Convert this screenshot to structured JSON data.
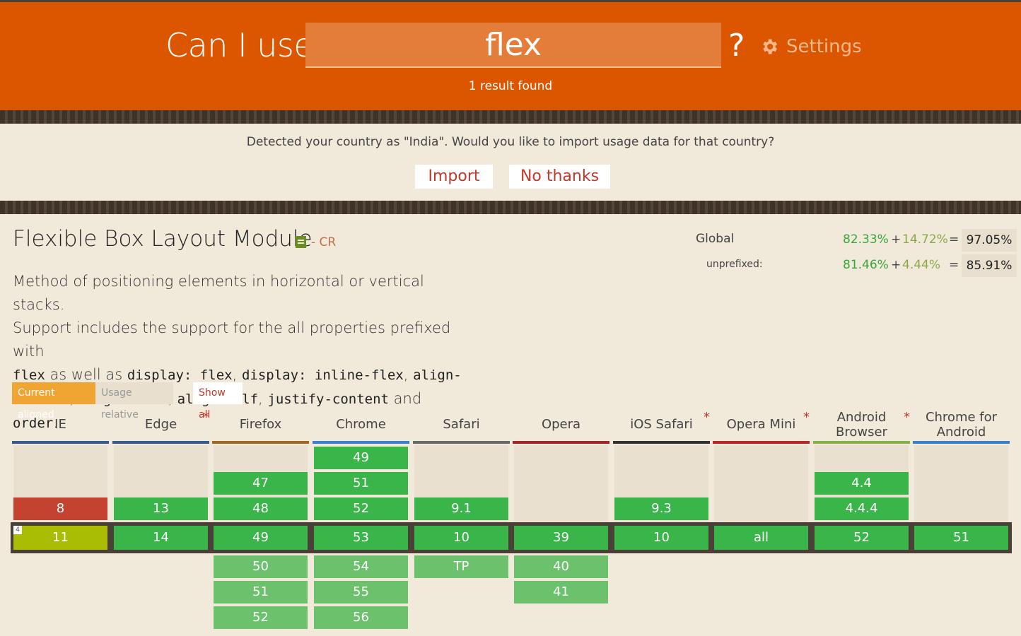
{
  "header": {
    "brand": "Can I use",
    "search_value": "flex",
    "question_mark": "?",
    "settings_label": "Settings",
    "results": "1 result found"
  },
  "notice": {
    "text": "Detected your country as \"India\". Would you like to import usage data for that country?",
    "import_label": "Import",
    "no_thanks_label": "No thanks"
  },
  "feature": {
    "title": "Flexible Box Layout Module",
    "status": "- CR",
    "description_line1": "Method of positioning elements in horizontal or vertical stacks.",
    "description_line2": "Support includes the support for the all properties prefixed with",
    "code_flex": "flex",
    "text_as_well_as": " as well as ",
    "code_display_flex": "display: flex",
    "comma": ", ",
    "code_display_inline_flex": "display: inline-flex",
    "code_align": "align-",
    "code_content": "content",
    "code_align_items": "align-items",
    "code_align_self": "align-self",
    "code_justify_content": "justify-content",
    "text_and": " and ",
    "code_order": "order",
    "period": "."
  },
  "stats": {
    "global_label": "Global",
    "global_full": "82.33%",
    "global_partial": "14.72%",
    "global_total": "97.05%",
    "unprefixed_label": "unprefixed:",
    "unprefixed_full": "81.46%",
    "unprefixed_partial": "4.44%",
    "unprefixed_total": "85.91%",
    "plus": "+",
    "equals": "="
  },
  "toggles": {
    "current_aligned": "Current aligned",
    "usage_relative": "Usage relative",
    "show_all": "Show all"
  },
  "browsers": [
    {
      "name": "IE",
      "color": "#3a5b8c",
      "star": ""
    },
    {
      "name": "Edge",
      "color": "#3a5b8c",
      "star": "*"
    },
    {
      "name": "Firefox",
      "color": "#a1682a",
      "star": ""
    },
    {
      "name": "Chrome",
      "color": "#3f7fc7",
      "star": ""
    },
    {
      "name": "Safari",
      "color": "#6a6a6a",
      "star": ""
    },
    {
      "name": "Opera",
      "color": "#9d2a2a",
      "star": ""
    },
    {
      "name": "iOS Safari",
      "color": "#333333",
      "star": "*"
    },
    {
      "name": "Opera Mini",
      "color": "#b22a2a",
      "star": "*"
    },
    {
      "name": "Android Browser",
      "color": "#88b04b",
      "star": "*"
    },
    {
      "name": "Chrome for Android",
      "color": "#3f7fc7",
      "star": ""
    }
  ],
  "versions": {
    "ie": {
      "past2": "8",
      "current": "11",
      "note": "4"
    },
    "edge": {
      "past2": "13",
      "current": "14"
    },
    "firefox": {
      "past1": "47",
      "past2": "48",
      "current": "49",
      "future1": "50",
      "future2": "51",
      "future3": "52"
    },
    "chrome": {
      "past0": "49",
      "past1": "51",
      "past2": "52",
      "current": "53",
      "future1": "54",
      "future2": "55",
      "future3": "56"
    },
    "safari": {
      "past2": "9.1",
      "current": "10",
      "future1": "TP"
    },
    "opera": {
      "current": "39",
      "future1": "40",
      "future2": "41"
    },
    "ios_safari": {
      "past2": "9.3",
      "current": "10"
    },
    "opera_mini": {
      "current": "all"
    },
    "android": {
      "past1": "4.4",
      "past2": "4.4.4",
      "current": "52"
    },
    "chrome_android": {
      "current": "51"
    }
  },
  "colors": {
    "header_bg": "#dc5600",
    "supported": "#39b54a",
    "not_supported": "#c44230",
    "partial": "#a8bd04",
    "future_supported": "#6cc26c"
  }
}
